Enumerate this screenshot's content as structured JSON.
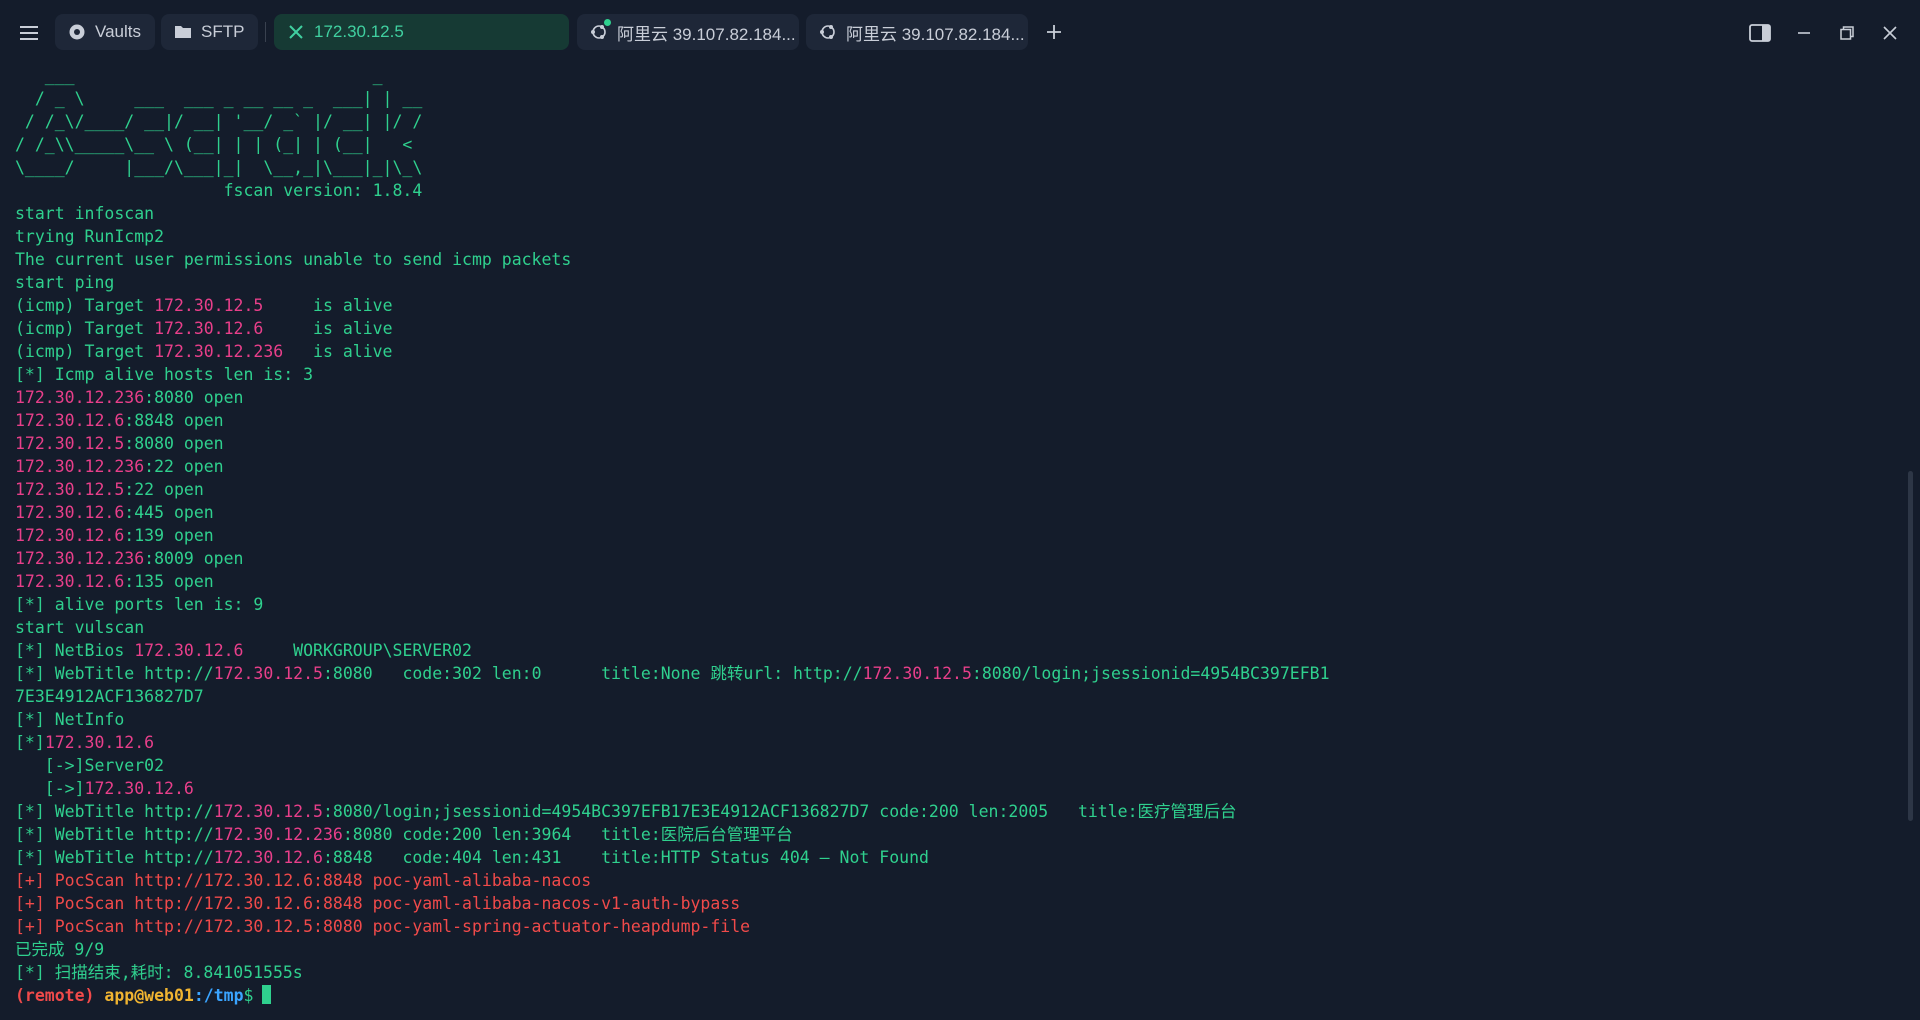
{
  "tabs": [
    {
      "label": "Vaults",
      "icon": "vault-icon"
    },
    {
      "label": "SFTP",
      "icon": "folder-icon"
    },
    {
      "label": "172.30.12.5",
      "icon": "close-icon",
      "active": true
    },
    {
      "label": "阿里云 39.107.82.184...",
      "icon": "ubuntu-icon",
      "status_dot": true
    },
    {
      "label": "阿里云 39.107.82.184...",
      "icon": "ubuntu-icon"
    }
  ],
  "colors": {
    "background": "#141c2b",
    "text_green": "#2fd08e",
    "ip_pink": "#e83f8a",
    "poc_red": "#f04a4a",
    "prompt_user": "#f0b431",
    "prompt_path": "#3aa4ff",
    "active_tab_bg": "#163a34"
  },
  "terminal": {
    "banner": [
      "   ___                              _",
      "  / _ \\     ___  ___ _ __ __ _  ___| | __",
      " / /_\\/____/ __|/ __| '__/ _` |/ __| |/ /",
      "/ /_\\\\_____\\__ \\ (__| | | (_| | (__|   <",
      "\\____/     |___/\\___|_|  \\__,_|\\___|_|\\_\\",
      "                     fscan version: 1.8.4"
    ],
    "info_lines": [
      "start infoscan",
      "trying RunIcmp2",
      "The current user permissions unable to send icmp packets",
      "start ping"
    ],
    "ping_results": [
      {
        "prefix": "(icmp) Target ",
        "ip": "172.30.12.5",
        "suffix": "     is alive"
      },
      {
        "prefix": "(icmp) Target ",
        "ip": "172.30.12.6",
        "suffix": "     is alive"
      },
      {
        "prefix": "(icmp) Target ",
        "ip": "172.30.12.236",
        "suffix": "   is alive"
      }
    ],
    "alive_hosts": "[*] Icmp alive hosts len is: 3",
    "ports": [
      {
        "ip": "172.30.12.236",
        "rest": ":8080 open"
      },
      {
        "ip": "172.30.12.6",
        "rest": ":8848 open"
      },
      {
        "ip": "172.30.12.5",
        "rest": ":8080 open"
      },
      {
        "ip": "172.30.12.236",
        "rest": ":22 open"
      },
      {
        "ip": "172.30.12.5",
        "rest": ":22 open"
      },
      {
        "ip": "172.30.12.6",
        "rest": ":445 open"
      },
      {
        "ip": "172.30.12.6",
        "rest": ":139 open"
      },
      {
        "ip": "172.30.12.236",
        "rest": ":8009 open"
      },
      {
        "ip": "172.30.12.6",
        "rest": ":135 open"
      }
    ],
    "alive_ports": "[*] alive ports len is: 9",
    "start_vulscan": "start vulscan",
    "netbios": {
      "prefix": "[*] NetBios ",
      "ip": "172.30.12.6",
      "suffix": "     WORKGROUP\\SERVER02"
    },
    "webtitle1": {
      "prefix": "[*] WebTitle http://",
      "ip": "172.30.12.5",
      "middle": ":8080   code:302 len:0      title:None 跳转url: http://",
      "ip2": "172.30.12.5",
      "suffix": ":8080/login;jsessionid=4954BC397EFB1"
    },
    "webtitle1_wrap": "7E3E4912ACF136827D7",
    "netinfo": "[*] NetInfo",
    "netinfo_ip": {
      "prefix": "[*]",
      "ip": "172.30.12.6"
    },
    "netinfo_server": "   [->]Server02",
    "netinfo_arrow_ip": {
      "prefix": "   [->]",
      "ip": "172.30.12.6"
    },
    "webtitles": [
      {
        "prefix": "[*] WebTitle http://",
        "ip": "172.30.12.5",
        "suffix": ":8080/login;jsessionid=4954BC397EFB17E3E4912ACF136827D7 code:200 len:2005   title:医疗管理后台"
      },
      {
        "prefix": "[*] WebTitle http://",
        "ip": "172.30.12.236",
        "suffix": ":8080 code:200 len:3964   title:医院后台管理平台"
      },
      {
        "prefix": "[*] WebTitle http://",
        "ip": "172.30.12.6",
        "suffix": ":8848   code:404 len:431    title:HTTP Status 404 – Not Found"
      }
    ],
    "pocscans": [
      "[+] PocScan http://172.30.12.6:8848 poc-yaml-alibaba-nacos",
      "[+] PocScan http://172.30.12.6:8848 poc-yaml-alibaba-nacos-v1-auth-bypass",
      "[+] PocScan http://172.30.12.5:8080 poc-yaml-spring-actuator-heapdump-file"
    ],
    "done": "已完成 9/9",
    "finished": "[*] 扫描结束,耗时: 8.841051555s",
    "prompt": {
      "remote": "(remote)",
      "user": "app@web01",
      "path": ":/tmp",
      "dollar": "$"
    }
  }
}
